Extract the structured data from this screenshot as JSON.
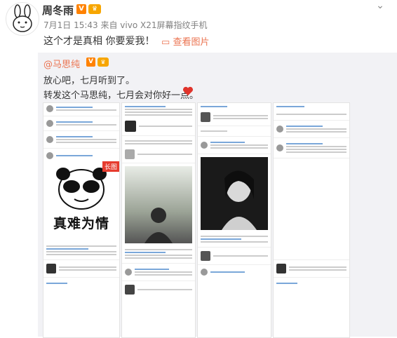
{
  "post": {
    "author": "周冬雨",
    "vip_badge": "V",
    "crown_badge": "♛",
    "meta": "7月1日 15:43 来自 vivo X21屏幕指纹手机",
    "content": "这个才是真相 你要爱我！",
    "view_pic_label": "查看图片",
    "more_icon": "chevron-down-icon"
  },
  "repost": {
    "author": "@马思纯",
    "vip_badge": "V",
    "crown_badge": "♛",
    "line1": "放心吧，七月听到了。",
    "line2": "转发这个马思纯，七月会对你好一点。",
    "long_badge": "长图",
    "panda_caption": "真难为情",
    "heart_color": "#e0342c"
  },
  "colors": {
    "link": "#eb7350",
    "repost_bg": "#f2f2f5",
    "vip": "#ff8200"
  }
}
